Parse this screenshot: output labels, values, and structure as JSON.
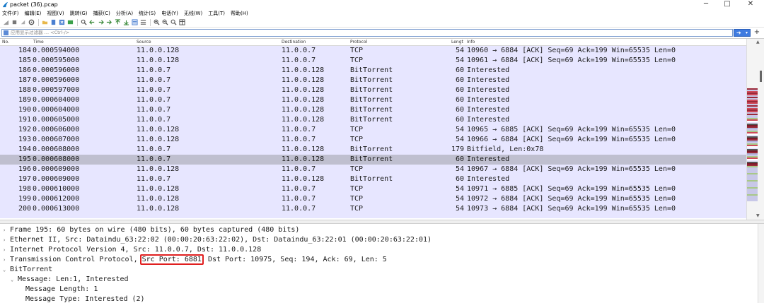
{
  "window": {
    "title": "packet (36).pcap",
    "minimize": "─",
    "maximize": "□",
    "close": "✕"
  },
  "menu": [
    "文件(F)",
    "编辑(E)",
    "视图(V)",
    "跳转(G)",
    "捕获(C)",
    "分析(A)",
    "统计(S)",
    "电话(Y)",
    "无线(W)",
    "工具(T)",
    "帮助(H)"
  ],
  "filter": {
    "placeholder": "应用显示过滤器 … <Ctrl-/>",
    "apply_arrow": "➔",
    "apply_caret": "▾",
    "add": "+"
  },
  "packet_list": {
    "columns": {
      "no": "No.",
      "time": "Time",
      "source": "Source",
      "destination": "Destination",
      "protocol": "Protocol",
      "length": "Lengt",
      "info": "Info"
    },
    "selected_index": 11,
    "rows": [
      {
        "no": "184",
        "time": "0.000594000",
        "src": "11.0.0.128",
        "dst": "11.0.0.7",
        "proto": "TCP",
        "len": "54",
        "info": "10960 → 6884 [ACK] Seq=69 Ack=199 Win=65535 Len=0"
      },
      {
        "no": "185",
        "time": "0.000595000",
        "src": "11.0.0.128",
        "dst": "11.0.0.7",
        "proto": "TCP",
        "len": "54",
        "info": "10961 → 6884 [ACK] Seq=69 Ack=199 Win=65535 Len=0"
      },
      {
        "no": "186",
        "time": "0.000596000",
        "src": "11.0.0.7",
        "dst": "11.0.0.128",
        "proto": "BitTorrent",
        "len": "60",
        "info": "Interested"
      },
      {
        "no": "187",
        "time": "0.000596000",
        "src": "11.0.0.7",
        "dst": "11.0.0.128",
        "proto": "BitTorrent",
        "len": "60",
        "info": "Interested"
      },
      {
        "no": "188",
        "time": "0.000597000",
        "src": "11.0.0.7",
        "dst": "11.0.0.128",
        "proto": "BitTorrent",
        "len": "60",
        "info": "Interested"
      },
      {
        "no": "189",
        "time": "0.000604000",
        "src": "11.0.0.7",
        "dst": "11.0.0.128",
        "proto": "BitTorrent",
        "len": "60",
        "info": "Interested"
      },
      {
        "no": "190",
        "time": "0.000604000",
        "src": "11.0.0.7",
        "dst": "11.0.0.128",
        "proto": "BitTorrent",
        "len": "60",
        "info": "Interested"
      },
      {
        "no": "191",
        "time": "0.000605000",
        "src": "11.0.0.7",
        "dst": "11.0.0.128",
        "proto": "BitTorrent",
        "len": "60",
        "info": "Interested"
      },
      {
        "no": "192",
        "time": "0.000606000",
        "src": "11.0.0.128",
        "dst": "11.0.0.7",
        "proto": "TCP",
        "len": "54",
        "info": "10965 → 6885 [ACK] Seq=69 Ack=199 Win=65535 Len=0"
      },
      {
        "no": "193",
        "time": "0.000607000",
        "src": "11.0.0.128",
        "dst": "11.0.0.7",
        "proto": "TCP",
        "len": "54",
        "info": "10966 → 6884 [ACK] Seq=69 Ack=199 Win=65535 Len=0"
      },
      {
        "no": "194",
        "time": "0.000608000",
        "src": "11.0.0.7",
        "dst": "11.0.0.128",
        "proto": "BitTorrent",
        "len": "179",
        "info": "Bitfield, Len:0x78"
      },
      {
        "no": "195",
        "time": "0.000608000",
        "src": "11.0.0.7",
        "dst": "11.0.0.128",
        "proto": "BitTorrent",
        "len": "60",
        "info": "Interested"
      },
      {
        "no": "196",
        "time": "0.000609000",
        "src": "11.0.0.128",
        "dst": "11.0.0.7",
        "proto": "TCP",
        "len": "54",
        "info": "10967 → 6884 [ACK] Seq=69 Ack=199 Win=65535 Len=0"
      },
      {
        "no": "197",
        "time": "0.000609000",
        "src": "11.0.0.7",
        "dst": "11.0.0.128",
        "proto": "BitTorrent",
        "len": "60",
        "info": "Interested"
      },
      {
        "no": "198",
        "time": "0.000610000",
        "src": "11.0.0.128",
        "dst": "11.0.0.7",
        "proto": "TCP",
        "len": "54",
        "info": "10971 → 6885 [ACK] Seq=69 Ack=199 Win=65535 Len=0"
      },
      {
        "no": "199",
        "time": "0.000612000",
        "src": "11.0.0.128",
        "dst": "11.0.0.7",
        "proto": "TCP",
        "len": "54",
        "info": "10972 → 6884 [ACK] Seq=69 Ack=199 Win=65535 Len=0"
      },
      {
        "no": "200",
        "time": "0.000613000",
        "src": "11.0.0.128",
        "dst": "11.0.0.7",
        "proto": "TCP",
        "len": "54",
        "info": "10973 → 6884 [ACK] Seq=69 Ack=199 Win=65535 Len=0"
      }
    ]
  },
  "details": {
    "rows": [
      {
        "arrow": "›",
        "text": "Frame 195: 60 bytes on wire (480 bits), 60 bytes captured (480 bits)"
      },
      {
        "arrow": "›",
        "text": "Ethernet II, Src: Dataindu_63:22:02 (00:00:20:63:22:02), Dst: Dataindu_63:22:01 (00:00:20:63:22:01)"
      },
      {
        "arrow": "›",
        "text": "Internet Protocol Version 4, Src: 11.0.0.7, Dst: 11.0.0.128"
      },
      {
        "arrow": "›",
        "pre": "Transmission Control Protocol, ",
        "highlight": "Src Port: 6881",
        "post": " Dst Port: 10975, Seq: 194, Ack: 69, Len: 5"
      },
      {
        "arrow": "⌄",
        "text": "BitTorrent"
      },
      {
        "arrow": "⌄",
        "text": "Message: Len:1, Interested"
      },
      {
        "arrow": "",
        "text": "Message Length: 1"
      },
      {
        "arrow": "",
        "text": "Message Type: Interested (2)"
      }
    ]
  },
  "colors": {
    "row_bg": "#e7e6ff",
    "selected_bg": "#bfbfcf",
    "highlight_border": "#e02020",
    "accent": "#3f7be0"
  }
}
